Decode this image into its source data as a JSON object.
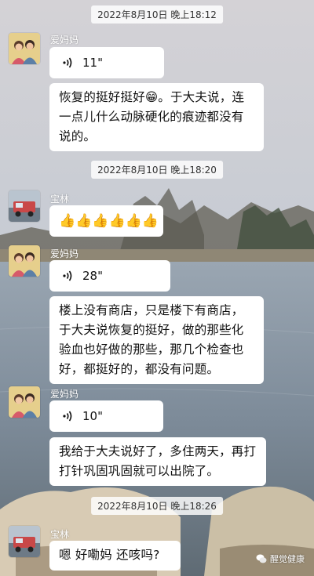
{
  "timestamps": [
    "2022年8月10日 晚上18:12",
    "2022年8月10日 晚上18:20",
    "2022年8月10日 晚上18:26"
  ],
  "messages": [
    {
      "sender": "爱妈妈",
      "type": "voice",
      "duration": "11\""
    },
    {
      "sender": "爱妈妈",
      "type": "text",
      "text": "恢复的挺好挺好😁。于大夫说，连一点儿什么动脉硬化的痕迹都没有说的。"
    },
    {
      "sender": "宝林",
      "type": "emoji",
      "count": 6,
      "emoji": "👍"
    },
    {
      "sender": "爱妈妈",
      "type": "voice",
      "duration": "28\""
    },
    {
      "sender": "爱妈妈",
      "type": "text",
      "text": "楼上没有商店，只是楼下有商店，于大夫说恢复的挺好，做的那些化验血也好做的那些，那几个检查也好，都挺好的，都没有问题。"
    },
    {
      "sender": "爱妈妈",
      "type": "voice",
      "duration": "10\""
    },
    {
      "sender": "爱妈妈",
      "type": "text",
      "text": "我给于大夫说好了，多住两天，再打打针巩固巩固就可以出院了。"
    },
    {
      "sender": "宝林",
      "type": "text",
      "text": "嗯 好嘞妈   还咳吗?"
    }
  ],
  "names": {
    "mom": "爱妈妈",
    "baolin": "宝林"
  },
  "watermark": "醒觉健康",
  "colors": {
    "bubble": "#ffffff",
    "sky": "#c9cdd5",
    "water": "#7f8d9c"
  }
}
